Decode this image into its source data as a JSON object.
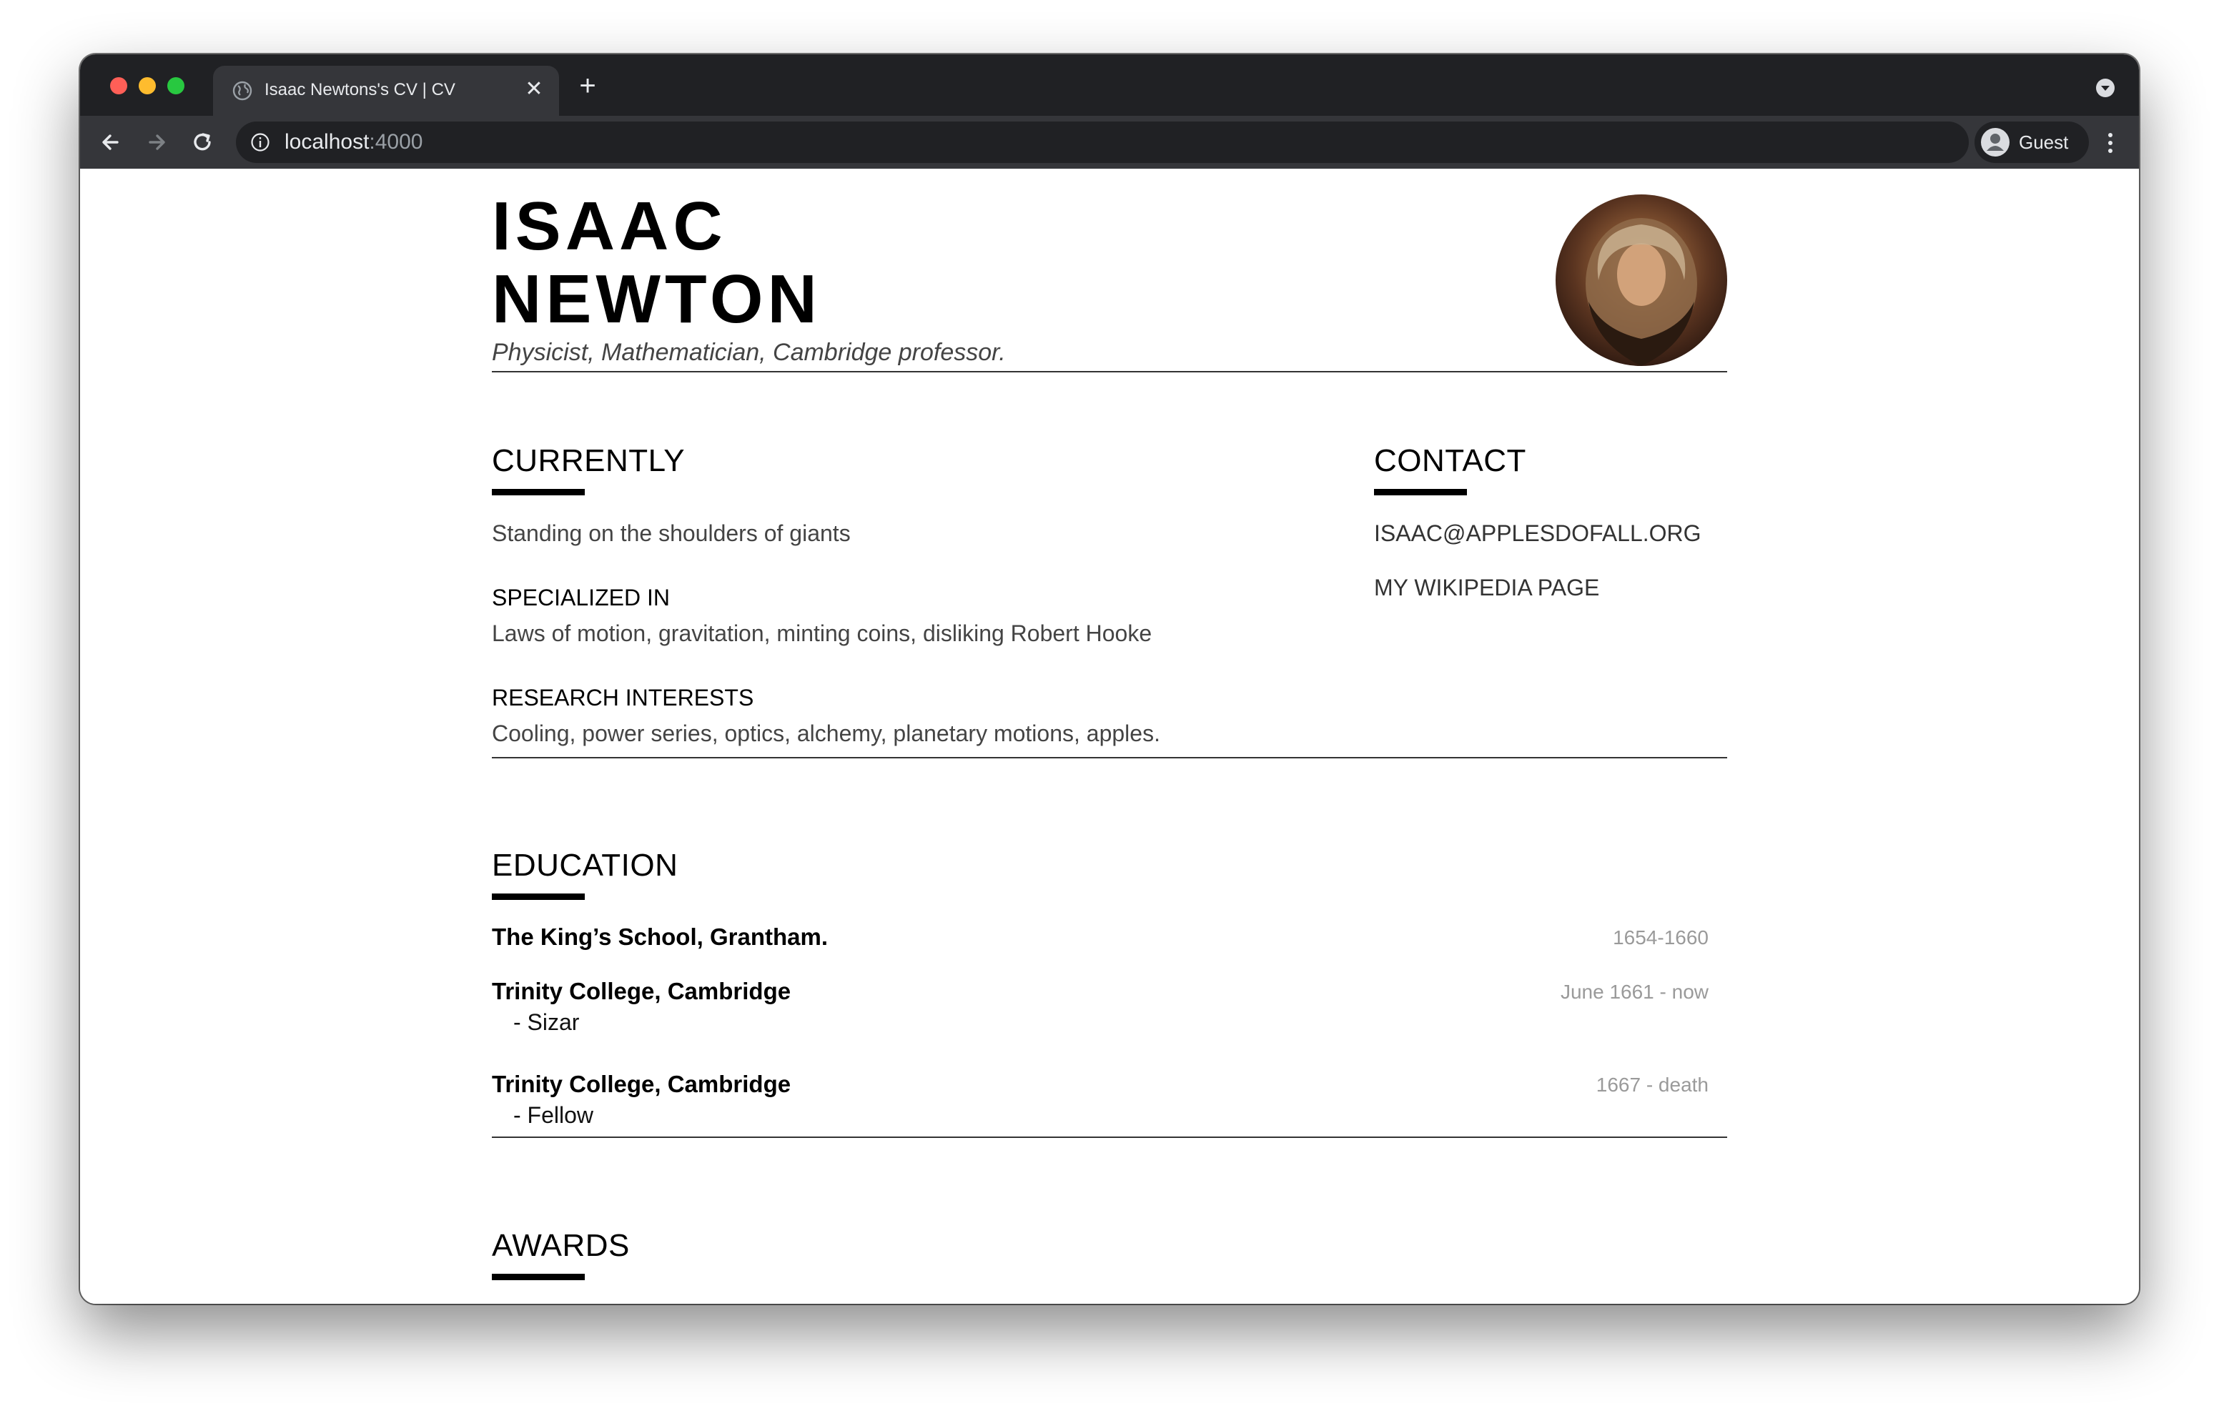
{
  "browser": {
    "tab_title": "Isaac Newtons's CV | CV",
    "url_host": "localhost",
    "url_port": ":4000",
    "profile_label": "Guest",
    "new_tab_label": "+",
    "close_label": "✕"
  },
  "header": {
    "first_name": "ISAAC",
    "last_name": "NEWTON",
    "tagline": "Physicist, Mathematician, Cambridge professor."
  },
  "currently": {
    "title": "CURRENTLY",
    "text": "Standing on the shoulders of giants",
    "specialized_heading": "SPECIALIZED IN",
    "specialized_text": "Laws of motion, gravitation, minting coins, disliking Robert Hooke",
    "research_heading": "RESEARCH INTERESTS",
    "research_text": "Cooling, power series, optics, alchemy, planetary motions, apples."
  },
  "contact": {
    "title": "CONTACT",
    "email": "ISAAC@APPLESDOFALL.ORG",
    "wikipedia": "MY WIKIPEDIA PAGE"
  },
  "education": {
    "title": "EDUCATION",
    "items": [
      {
        "institution": "The King’s School, Grantham.",
        "role": "",
        "dates": "1654-1660"
      },
      {
        "institution": "Trinity College, Cambridge",
        "role": "- Sizar",
        "dates": "June 1661 - now"
      },
      {
        "institution": "Trinity College, Cambridge",
        "role": "- Fellow",
        "dates": "1667 - death"
      }
    ]
  },
  "awards": {
    "title": "AWARDS"
  },
  "colors": {
    "tab_bar": "#202124",
    "toolbar": "#35363a",
    "text_dark": "#000000",
    "text_muted": "#9a9a9a"
  }
}
